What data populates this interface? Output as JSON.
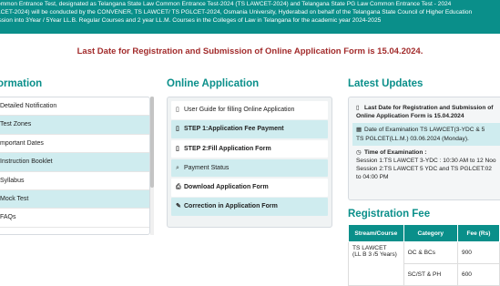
{
  "banner": {
    "lines": [
      "ommon Entrance Test, designated as Telangana State Law Common Entrance Test-2024 (TS LAWCET-2024) and Telangana State PG Law Common Entrance Test - 2024",
      "LCET-2024) will be conducted by the CONVENER, TS LAWCET/ TS PGLCET-2024, Osmania University, Hyderabad on behalf of the Telangana State Council of Higher Education",
      "ission into 3Year / 5Year LL.B. Regular Courses and 2 year LL.M. Courses in the Colleges of Law in Telangana for the academic year 2024-2025"
    ]
  },
  "deadline": "Last Date for Registration and Submission of Online Application Form is 15.04.2024.",
  "information": {
    "title": "ormation",
    "items": [
      {
        "label": "Detailed Notification",
        "highlight": false
      },
      {
        "label": "Test Zones",
        "highlight": true
      },
      {
        "label": "mportant Dates",
        "highlight": false
      },
      {
        "label": "Instruction Booklet",
        "highlight": true
      },
      {
        "label": "Syllabus",
        "highlight": false
      },
      {
        "label": "Mock Test",
        "highlight": true
      },
      {
        "label": "FAQs",
        "highlight": false
      }
    ]
  },
  "online_application": {
    "title": "Online Application",
    "items": [
      {
        "label": "User Guide for filling Online Application",
        "icon": "document-icon",
        "glyph": "▯",
        "highlight": false,
        "bold": false
      },
      {
        "label": "STEP 1:Application Fee Payment",
        "icon": "document-icon",
        "glyph": "▯",
        "highlight": true,
        "bold": true
      },
      {
        "label": "STEP 2:Fill Application Form",
        "icon": "document-icon",
        "glyph": "▯",
        "highlight": false,
        "bold": true
      },
      {
        "label": "Payment Status",
        "icon": "search-icon",
        "glyph": "⌕",
        "highlight": true,
        "bold": false
      },
      {
        "label": "Download Application Form",
        "icon": "print-icon",
        "glyph": "⎙",
        "highlight": false,
        "bold": true
      },
      {
        "label": "Correction in Application Form",
        "icon": "edit-icon",
        "glyph": "✎",
        "highlight": true,
        "bold": true
      }
    ]
  },
  "latest_updates": {
    "title": "Latest Updates",
    "items": [
      {
        "icon": "document-icon",
        "glyph": "▯",
        "highlight": false,
        "lines": [
          {
            "text": "Last Date for Registration and Submission of",
            "bold": true
          },
          {
            "text": "Online Application Form is 15.04.2024",
            "bold": true
          }
        ]
      },
      {
        "icon": "calendar-icon",
        "glyph": "▦",
        "highlight": true,
        "lines": [
          {
            "text": "Date of Examination   TS LAWCET(3-YDC & 5",
            "bold": false
          },
          {
            "text": "TS PGLCET(LL.M.) 03.06.2024 (Monday).",
            "bold": false
          }
        ]
      },
      {
        "icon": "clock-icon",
        "glyph": "◷",
        "highlight": false,
        "lines": [
          {
            "text": "Time of Examination :",
            "bold": true
          },
          {
            "text": "Session 1:TS LAWCET 3-YDC : 10:30 AM to 12 Noo",
            "bold": false
          },
          {
            "text": "Session 2:TS LAWCET 5 YDC and TS PGLCET:02",
            "bold": false
          },
          {
            "text": "to 04:00 PM",
            "bold": false
          }
        ]
      }
    ]
  },
  "registration_fee": {
    "title": "Registration Fee",
    "headers": [
      "Stream/Course",
      "Category",
      "Fee (Rs)"
    ],
    "rows": [
      {
        "course": "TS LAWCET",
        "course2": "(LL B 3 /5 Years)",
        "category": "OC & BCs",
        "fee": "900"
      },
      {
        "course": "",
        "course2": "",
        "category": "SC/ST & PH",
        "fee": "600"
      }
    ]
  }
}
